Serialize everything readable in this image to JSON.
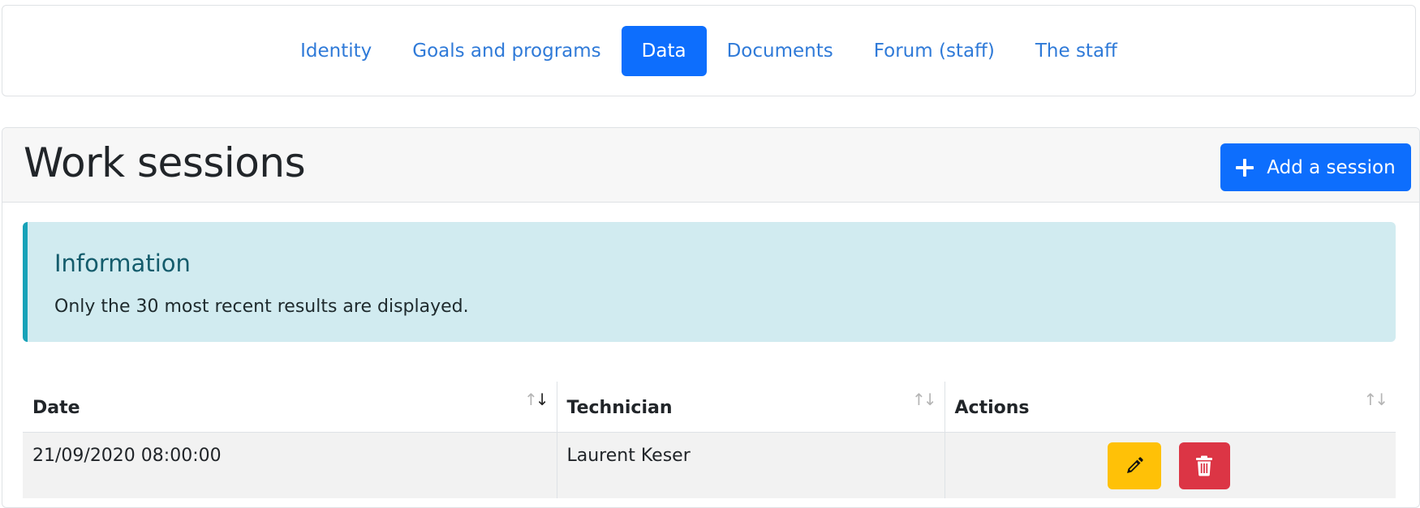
{
  "nav": {
    "tabs": [
      {
        "label": "Identity"
      },
      {
        "label": "Goals and programs"
      },
      {
        "label": "Data"
      },
      {
        "label": "Documents"
      },
      {
        "label": "Forum (staff)"
      },
      {
        "label": "The staff"
      }
    ],
    "active_tab": "Data"
  },
  "sessions": {
    "title": "Work sessions",
    "add_label": "Add a session"
  },
  "info": {
    "title": "Information",
    "text": "Only the 30 most recent results are displayed."
  },
  "table": {
    "headers": {
      "date": "Date",
      "technician": "Technician",
      "actions": "Actions"
    },
    "rows": [
      {
        "date": "21/09/2020 08:00:00",
        "technician": "Laurent Keser"
      }
    ]
  },
  "colors": {
    "primary": "#0d6efd",
    "link": "#2f7ad8",
    "info_bg": "#d1ebf0",
    "info_border": "#17a2b8",
    "edit": "#ffc107",
    "delete": "#dc3545"
  },
  "icons": {
    "add": "plus-icon",
    "edit": "pencil-icon",
    "delete": "trash-icon",
    "sort": "sort-arrows-icon"
  }
}
